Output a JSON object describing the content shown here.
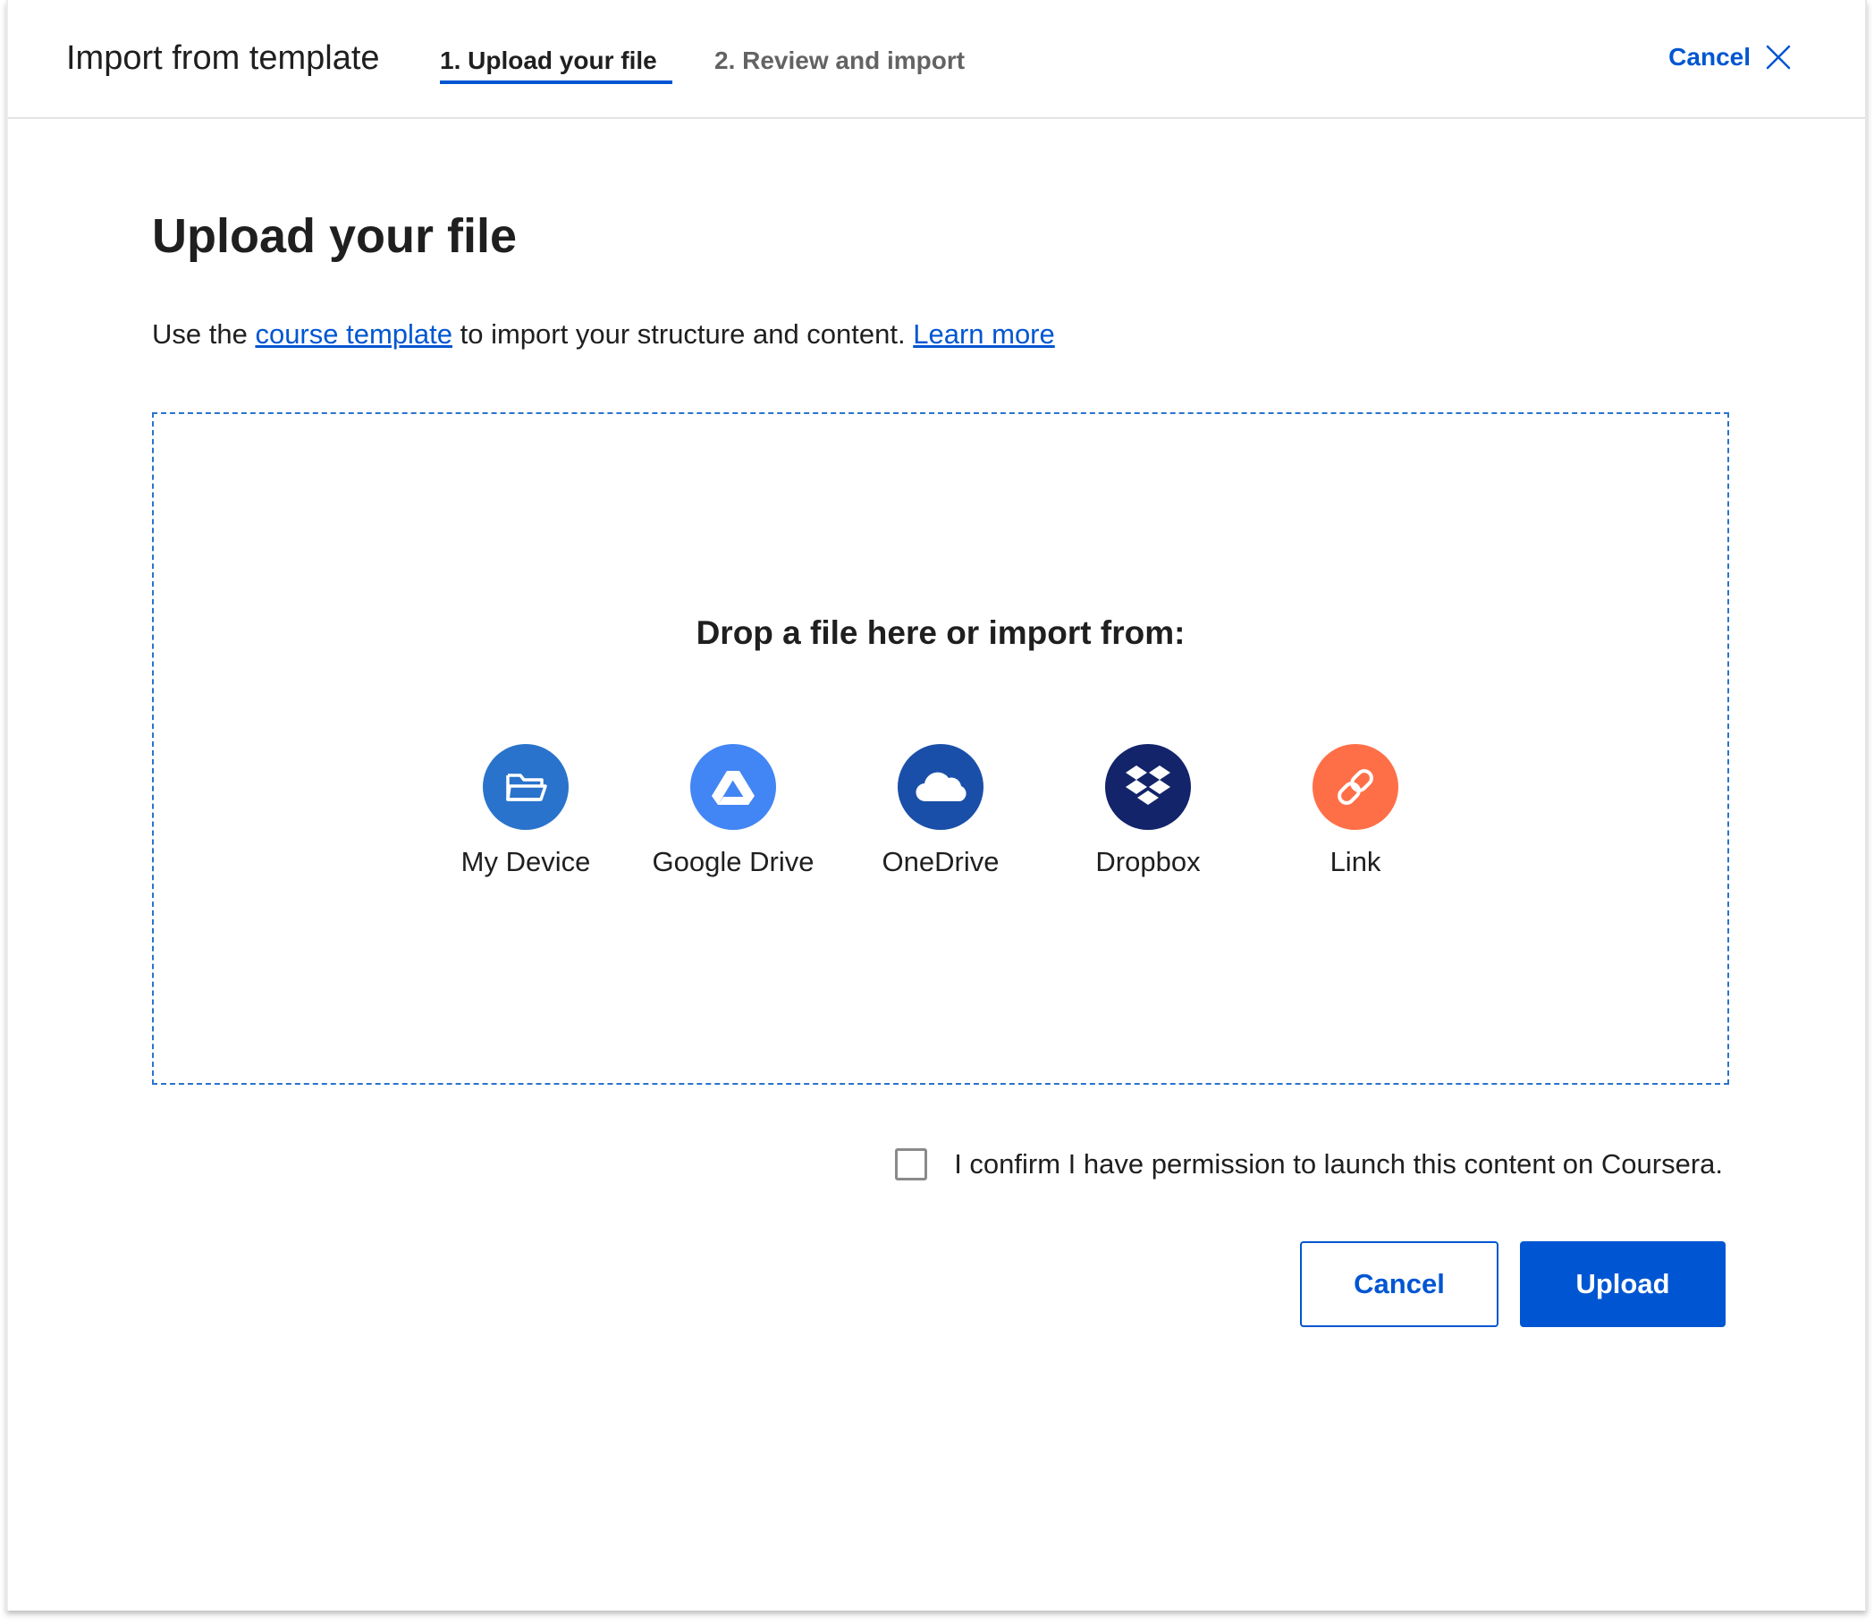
{
  "header": {
    "title": "Import from template",
    "steps": [
      {
        "label": "1. Upload your file",
        "active": true
      },
      {
        "label": "2. Review and import",
        "active": false
      }
    ],
    "cancel_label": "Cancel"
  },
  "main": {
    "title": "Upload your file",
    "intro": {
      "prefix": "Use the ",
      "template_link": "course template",
      "middle": " to import your structure and content. ",
      "learn_more_link": "Learn more"
    },
    "dropzone": {
      "heading": "Drop a file here or import from:",
      "sources": [
        {
          "label": "My Device",
          "icon": "folder-icon",
          "color": "#2a73cc"
        },
        {
          "label": "Google Drive",
          "icon": "google-drive-icon",
          "color": "#4285f4"
        },
        {
          "label": "OneDrive",
          "icon": "onedrive-icon",
          "color": "#1a4fa9"
        },
        {
          "label": "Dropbox",
          "icon": "dropbox-icon",
          "color": "#13246b"
        },
        {
          "label": "Link",
          "icon": "link-icon",
          "color": "#ff6f47"
        }
      ]
    },
    "confirm_label": "I confirm I have permission to launch this content on Coursera.",
    "buttons": {
      "cancel": "Cancel",
      "upload": "Upload"
    }
  },
  "colors": {
    "accent": "#0056d2",
    "dropzone_border": "#2a73cc"
  }
}
